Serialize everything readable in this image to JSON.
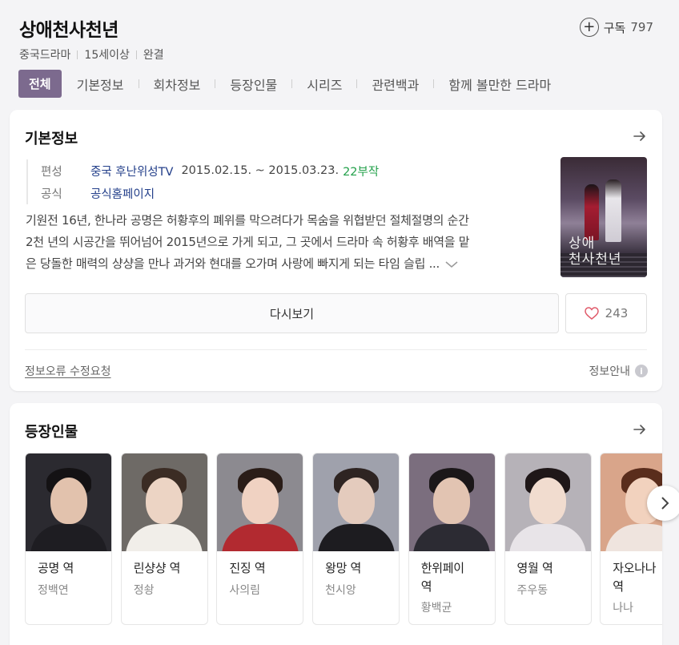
{
  "header": {
    "title": "상애천사천년",
    "subscribe_label": "구독",
    "subscribe_count": "797",
    "meta": [
      "중국드라마",
      "15세이상",
      "완결"
    ]
  },
  "tabs": [
    {
      "label": "전체",
      "active": true
    },
    {
      "label": "기본정보"
    },
    {
      "label": "회차정보"
    },
    {
      "label": "등장인물"
    },
    {
      "label": "시리즈"
    },
    {
      "label": "관련백과"
    },
    {
      "label": "함께 볼만한 드라마"
    }
  ],
  "basic": {
    "title": "기본정보",
    "broadcast_label": "편성",
    "broadcaster": "중국 후난위성TV",
    "dates": "2015.02.15. ~ 2015.03.23.",
    "episodes": "22부작",
    "official_label": "공식",
    "official_link": "공식홈페이지",
    "desc_lines": [
      "기원전 16년, 한나라 공명은 허황후의 폐위를 막으려다가 목숨을 위협받던 절체절명의 순간",
      "2천 년의 시공간을 뛰어넘어 2015년으로 가게 되고, 그 곳에서 드라마 속 허황후 배역을 맡",
      "은 당돌한 매력의 샹샹을 만나 과거와 현대를 오가며 사랑에 빠지게 되는 타임 슬립 ..."
    ],
    "poster_title_lines": [
      "상애",
      "천사천년"
    ],
    "rewatch_label": "다시보기",
    "like_count": "243",
    "report_label": "정보오류 수정요청",
    "info_guide_label": "정보안내",
    "info_icon_glyph": "i"
  },
  "cast": {
    "title": "등장인물",
    "members": [
      {
        "role": [
          "공명 역"
        ],
        "actor": "정백연",
        "bg": "#2b2a30",
        "skin": "#e2c2ad",
        "hair": "#141214",
        "body": "#1e1d22"
      },
      {
        "role": [
          "린샹샹 역"
        ],
        "actor": "정솽",
        "bg": "#6e6a66",
        "skin": "#ecd4c4",
        "hair": "#3b2c24",
        "body": "#f1eee9"
      },
      {
        "role": [
          "진징 역"
        ],
        "actor": "사의림",
        "bg": "#8c8a90",
        "skin": "#f0d2c2",
        "hair": "#2a1d18",
        "body": "#b22a30"
      },
      {
        "role": [
          "왕망 역"
        ],
        "actor": "천시앙",
        "bg": "#9fa1ac",
        "skin": "#e4cbbd",
        "hair": "#2e2422",
        "body": "#1d1c20"
      },
      {
        "role": [
          "한위페이",
          "역"
        ],
        "actor": "황백균",
        "bg": "#7b6e7e",
        "skin": "#e2c4b2",
        "hair": "#1b1719",
        "body": "#2c2b33"
      },
      {
        "role": [
          "영월 역"
        ],
        "actor": "주우동",
        "bg": "#b6b2b8",
        "skin": "#f1dccf",
        "hair": "#1f1718",
        "body": "#e8e4e8"
      },
      {
        "role": [
          "자오나나",
          "역"
        ],
        "actor": "나나",
        "bg": "#d9a58a",
        "skin": "#f2d2be",
        "hair": "#5a2d1c",
        "body": "#efe4de"
      }
    ]
  },
  "colors": {
    "tab_active": "#7c6a8e",
    "link": "#233f8a",
    "episodes": "#22a04a",
    "heart": "#e05a6a"
  }
}
